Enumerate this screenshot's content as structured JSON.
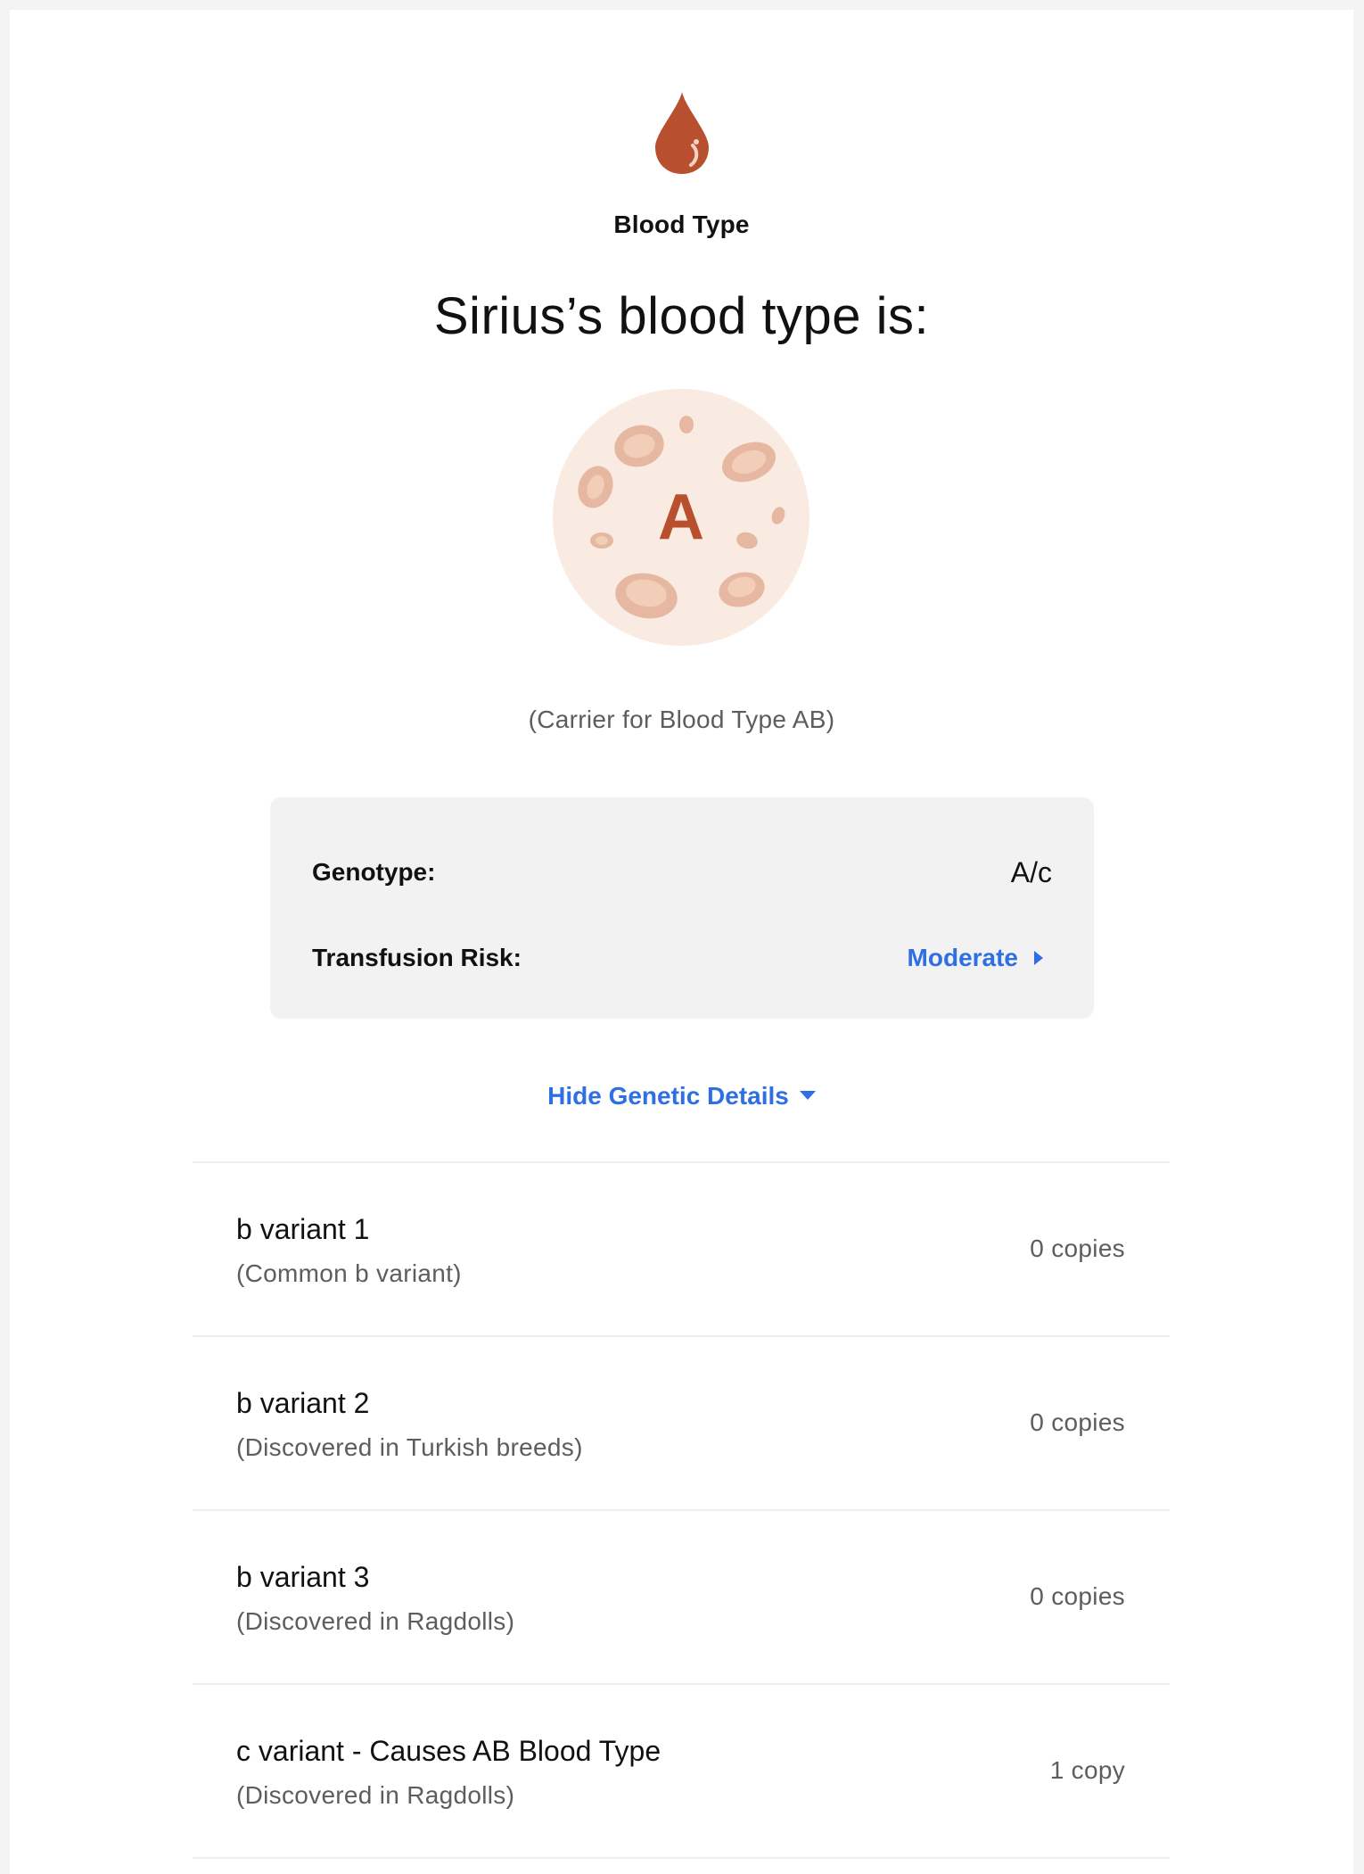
{
  "header": {
    "icon": "blood-drop-icon",
    "section_label": "Blood Type",
    "headline": "Sirius’s blood type is:"
  },
  "blood_type": {
    "letter": "A",
    "illustration": "blood-cells-icon",
    "carrier_note": "(Carrier for Blood Type AB)"
  },
  "summary": {
    "genotype_label": "Genotype:",
    "genotype_value": "A/c",
    "risk_label": "Transfusion Risk:",
    "risk_value": "Moderate"
  },
  "toggle": {
    "label": "Hide Genetic Details"
  },
  "variants": [
    {
      "name": "b variant 1",
      "description": "(Common b variant)",
      "copies": "0 copies"
    },
    {
      "name": "b variant 2",
      "description": "(Discovered in Turkish breeds)",
      "copies": "0 copies"
    },
    {
      "name": "b variant 3",
      "description": "(Discovered in Ragdolls)",
      "copies": "0 copies"
    },
    {
      "name": "c variant - Causes AB Blood Type",
      "description": "(Discovered in Ragdolls)",
      "copies": "1 copy"
    }
  ],
  "colors": {
    "accent_blue": "#2f6fe4",
    "blood_red": "#b8502f",
    "cell_fill": "#e6b8a2",
    "circle_bg": "#f9ebe1"
  }
}
